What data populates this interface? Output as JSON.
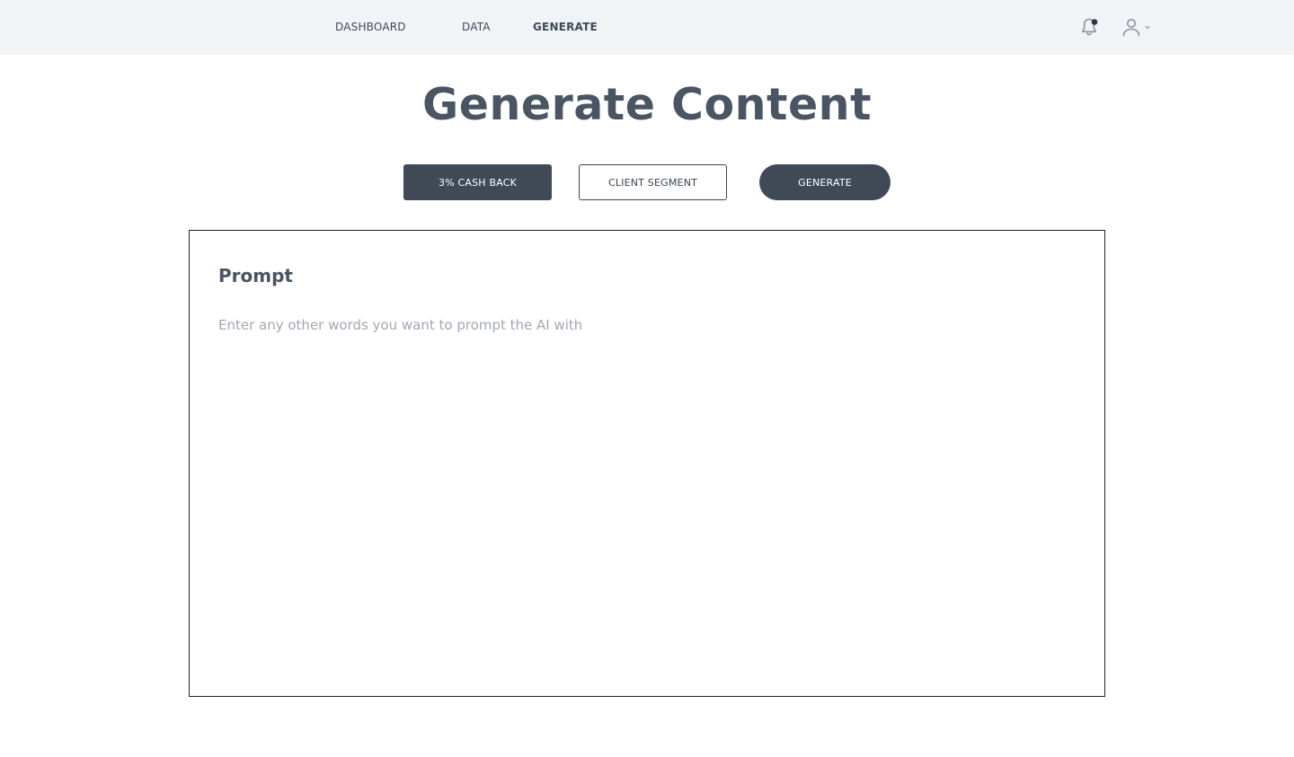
{
  "nav": {
    "items": [
      {
        "label": "DASHBOARD",
        "active": false
      },
      {
        "label": "DATA",
        "active": false
      },
      {
        "label": "GENERATE",
        "active": true
      }
    ],
    "icons": {
      "notification": "bell-icon",
      "notification_badge": true,
      "user": "user-icon",
      "user_menu": "chevron-down-icon"
    }
  },
  "page": {
    "title": "Generate Content"
  },
  "actions": {
    "cashback_label": "3% CASH BACK",
    "segment_label": "CLIENT SEGMENT",
    "generate_label": "GENERATE"
  },
  "prompt": {
    "label": "Prompt",
    "value": "",
    "placeholder": "Enter any other words you want to prompt the AI with"
  },
  "colors": {
    "nav_background": "#f0f4f7",
    "primary": "#404a57",
    "title_text": "#4a5563",
    "placeholder": "#a0a8b2"
  }
}
